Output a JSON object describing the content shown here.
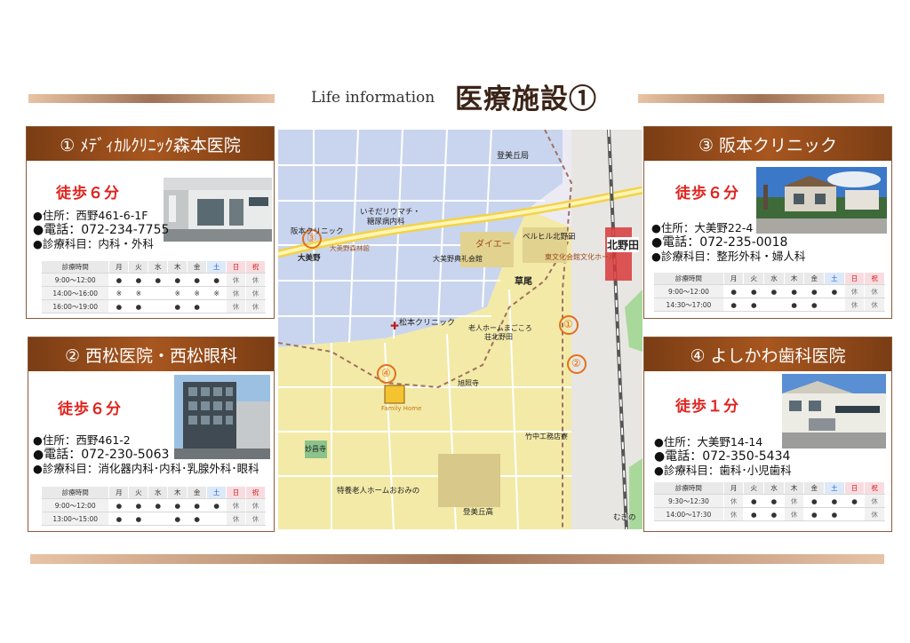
{
  "header": {
    "subtitle": "Life information",
    "title": "医療施設①"
  },
  "cards": [
    {
      "title": "① ﾒﾃﾞｨｶﾙｸﾘﾆｯｸ森本医院",
      "walk": "徒歩６分",
      "address": "●住所：西野461-6-1F",
      "phone": "●電話：072-234-7755",
      "dept": "●診療科目：内科・外科",
      "hours": {
        "head": [
          "診療時間",
          "月",
          "火",
          "水",
          "木",
          "金",
          "土",
          "日",
          "祝"
        ],
        "rows": [
          [
            "9:00～12:00",
            "●",
            "●",
            "●",
            "●",
            "●",
            "●",
            "休",
            "休"
          ],
          [
            "14:00～16:00",
            "※",
            "※",
            "",
            "※",
            "※",
            "※",
            "休",
            "休"
          ],
          [
            "16:00～19:00",
            "●",
            "●",
            "",
            "●",
            "●",
            "",
            "休",
            "休"
          ]
        ]
      }
    },
    {
      "title": "② 西松医院・西松眼科",
      "walk": "徒歩６分",
      "address": "●住所：西野461-2",
      "phone": "●電話：072-230-5063",
      "dept": "●診療科目：消化器内科･内科･乳腺外科･眼科",
      "hours": {
        "head": [
          "診療時間",
          "月",
          "火",
          "水",
          "木",
          "金",
          "土",
          "日",
          "祝"
        ],
        "rows": [
          [
            "9:00～12:00",
            "●",
            "●",
            "●",
            "●",
            "●",
            "●",
            "休",
            "休"
          ],
          [
            "13:00～15:00",
            "●",
            "●",
            "",
            "●",
            "●",
            "",
            "休",
            "休"
          ]
        ]
      }
    },
    {
      "title": "③ 阪本クリニック",
      "walk": "徒歩６分",
      "address": "●住所：大美野22-4",
      "phone": "●電話：072-235-0018",
      "dept": "●診療科目：整形外科・婦人科",
      "hours": {
        "head": [
          "診療時間",
          "月",
          "火",
          "水",
          "木",
          "金",
          "土",
          "日",
          "祝"
        ],
        "rows": [
          [
            "9:00～12:00",
            "●",
            "●",
            "●",
            "●",
            "●",
            "●",
            "休",
            "休"
          ],
          [
            "14:30～17:00",
            "●",
            "●",
            "",
            "●",
            "●",
            "",
            "休",
            "休"
          ]
        ]
      }
    },
    {
      "title": "④ よしかわ歯科医院",
      "walk": "徒歩１分",
      "address": "●住所：大美野14-14",
      "phone": "●電話：072-350-5434",
      "dept": "●診療科目：歯科･小児歯科",
      "hours": {
        "head": [
          "診療時間",
          "月",
          "火",
          "水",
          "木",
          "金",
          "土",
          "日",
          "祝"
        ],
        "rows": [
          [
            "9:30～12:30",
            "休",
            "●",
            "●",
            "休",
            "●",
            "●",
            "●",
            "休"
          ],
          [
            "14:00～17:30",
            "休",
            "●",
            "●",
            "休",
            "●",
            "●",
            "",
            "休"
          ]
        ]
      }
    }
  ],
  "map": {
    "labels": {
      "tomioka_post": "登美丘局",
      "izoda": "いそだリウマチ・",
      "izoda2": "糖尿病内科",
      "sakamoto": "阪本クリニック",
      "oomino": "大美野",
      "oomino_st": "大美野森林館",
      "daiei": "ダイエー",
      "bell": "ベルヒル北野田",
      "oomino_hall": "大美野典礼会館",
      "bunka": "東文化会館文化ホール",
      "kitanoda": "北野田",
      "kusao": "草尾",
      "matsumoto": "松本クリニック",
      "rojin": "老人ホームまごころ",
      "rojin2": "荘北野田",
      "myoshoji": "妙昌寺",
      "tokuyo": "特養老人ホームおおみの",
      "takenaka": "竹中工務店寮",
      "tomioka_hs": "登美丘高",
      "mukino": "むぎの",
      "asahi": "旭照寺",
      "family": "Family Home"
    },
    "markers": [
      "①",
      "②",
      "③",
      "④"
    ]
  }
}
